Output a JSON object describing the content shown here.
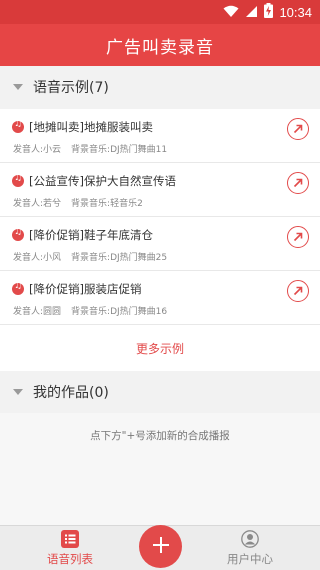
{
  "status_bar": {
    "time": "10:34",
    "icons": [
      "wifi-icon",
      "signal-icon",
      "battery-charging-icon"
    ]
  },
  "app_bar": {
    "title": "广告叫卖录音"
  },
  "examples_section": {
    "title": "语音示例(7)",
    "items": [
      {
        "title": "[地摊叫卖]地摊服装叫卖",
        "speaker": "发音人:小云",
        "music": "背景音乐:DJ热门舞曲11"
      },
      {
        "title": "[公益宣传]保护大自然宣传语",
        "speaker": "发音人:若兮",
        "music": "背景音乐:轻音乐2"
      },
      {
        "title": "[降价促销]鞋子年底清仓",
        "speaker": "发音人:小风",
        "music": "背景音乐:DJ热门舞曲25"
      },
      {
        "title": "[降价促销]服装店促销",
        "speaker": "发音人:圆圆",
        "music": "背景音乐:DJ热门舞曲16"
      }
    ],
    "more_label": "更多示例"
  },
  "works_section": {
    "title": "我的作品(0)",
    "empty_hint": "点下方\"+号添加新的合成播报"
  },
  "bottom_nav": {
    "tabs": [
      {
        "label": "语音列表",
        "icon": "list-icon",
        "active": true
      },
      {
        "label": "用户中心",
        "icon": "user-icon",
        "active": false
      }
    ],
    "fab_icon": "plus-icon"
  },
  "colors": {
    "accent": "#e24a4a",
    "app_bar": "#e64545",
    "status_bar": "#d93a3a"
  }
}
